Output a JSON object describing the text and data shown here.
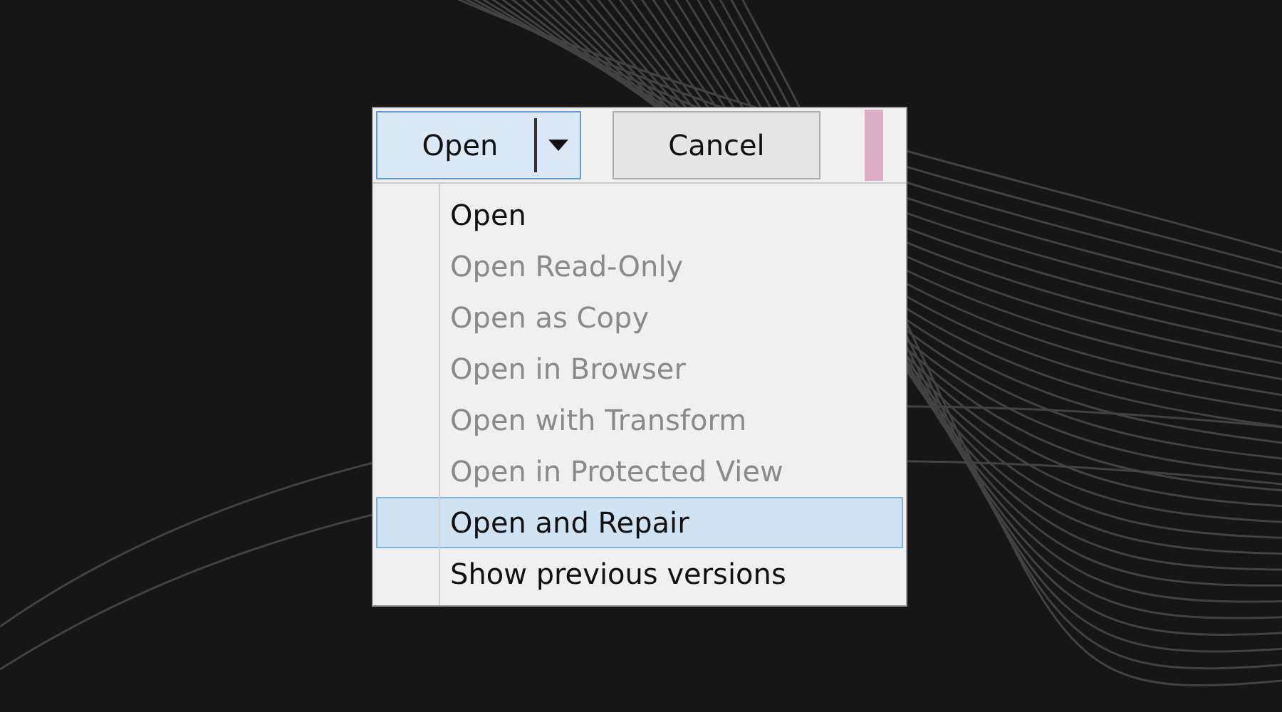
{
  "buttons": {
    "open": {
      "label": "Open",
      "expanded": true
    },
    "cancel": {
      "label": "Cancel"
    }
  },
  "menu": {
    "items": [
      {
        "label": "Open",
        "disabled": false,
        "selected": false
      },
      {
        "label": "Open Read-Only",
        "disabled": true,
        "selected": false
      },
      {
        "label": "Open as Copy",
        "disabled": true,
        "selected": false
      },
      {
        "label": "Open in Browser",
        "disabled": true,
        "selected": false
      },
      {
        "label": "Open with Transform",
        "disabled": true,
        "selected": false
      },
      {
        "label": "Open in Protected View",
        "disabled": true,
        "selected": false
      },
      {
        "label": "Open and Repair",
        "disabled": false,
        "selected": true
      },
      {
        "label": "Show previous versions",
        "disabled": false,
        "selected": false
      }
    ]
  }
}
